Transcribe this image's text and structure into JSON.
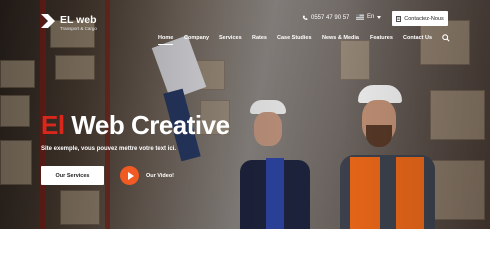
{
  "brand": {
    "name": "EL web",
    "tagline": "Transport & Cargo"
  },
  "header": {
    "phone": "0557 47 90 57",
    "language": "En",
    "contact_button": "Contactez-Nous"
  },
  "nav": {
    "items": [
      {
        "label": "Home",
        "active": true
      },
      {
        "label": "Company"
      },
      {
        "label": "Services"
      },
      {
        "label": "Rates"
      },
      {
        "label": "Case Studies"
      },
      {
        "label": "News & Media"
      },
      {
        "label": "Features"
      },
      {
        "label": "Contact Us"
      }
    ]
  },
  "hero": {
    "headline_highlight": "El",
    "headline_rest": " Web Creative",
    "subtitle": "Site exemple, vous pouvez mettre votre text ici.",
    "services_button": "Our Services",
    "video_label": "Our Video!"
  },
  "colors": {
    "accent": "#f15a22",
    "headline_red": "#d9271c"
  }
}
